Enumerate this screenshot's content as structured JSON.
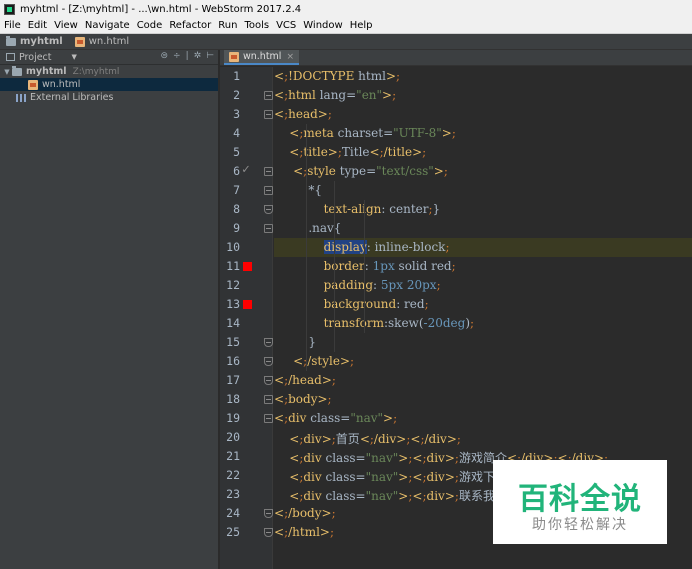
{
  "window": {
    "title": "myhtml - [Z:\\myhtml] - ...\\wn.html - WebStorm 2017.2.4"
  },
  "menu": [
    "File",
    "Edit",
    "View",
    "Navigate",
    "Code",
    "Refactor",
    "Run",
    "Tools",
    "VCS",
    "Window",
    "Help"
  ],
  "navbar": {
    "project": "myhtml",
    "file": "wn.html"
  },
  "sidebar": {
    "header_label": "Project",
    "tree": [
      {
        "label": "myhtml",
        "path": "Z:\\myhtml",
        "icon": "folder-icon"
      },
      {
        "label": "wn.html",
        "icon": "html-file-icon"
      },
      {
        "label": "External Libraries",
        "icon": "library-icon"
      }
    ]
  },
  "editor": {
    "tab_label": "wn.html",
    "current_line": 10,
    "breakpoint_lines": [
      11,
      13
    ],
    "check_line": 6,
    "lines": [
      {
        "n": 1,
        "text": "<!DOCTYPE html>"
      },
      {
        "n": 2,
        "text": "<html lang=\"en\">"
      },
      {
        "n": 3,
        "text": "<head>"
      },
      {
        "n": 4,
        "text": "    <meta charset=\"UTF-8\">"
      },
      {
        "n": 5,
        "text": "    <title>Title</title>"
      },
      {
        "n": 6,
        "text": "     <style type=\"text/css\">"
      },
      {
        "n": 7,
        "text": "         *{"
      },
      {
        "n": 8,
        "text": "             text-align: center;}"
      },
      {
        "n": 9,
        "text": "         .nav{"
      },
      {
        "n": 10,
        "text": "             display: inline-block;"
      },
      {
        "n": 11,
        "text": "             border: 1px solid red;"
      },
      {
        "n": 12,
        "text": "             padding: 5px 20px;"
      },
      {
        "n": 13,
        "text": "             background: red;"
      },
      {
        "n": 14,
        "text": "             transform:skew(-20deg);"
      },
      {
        "n": 15,
        "text": "         }"
      },
      {
        "n": 16,
        "text": "     </style>"
      },
      {
        "n": 17,
        "text": "</head>"
      },
      {
        "n": 18,
        "text": "<body>"
      },
      {
        "n": 19,
        "text": "<div class=\"nav\">"
      },
      {
        "n": 20,
        "text": "    <div>首页</div></div>"
      },
      {
        "n": 21,
        "text": "    <div class=\"nav\"><div>游戏简介</div></div>"
      },
      {
        "n": 22,
        "text": "    <div class=\"nav\"><div>游戏下载"
      },
      {
        "n": 23,
        "text": "    <div class=\"nav\"><div>联系我们"
      },
      {
        "n": 24,
        "text": "</body>"
      },
      {
        "n": 25,
        "text": "</html>"
      }
    ]
  },
  "watermark": {
    "title": "百科全说",
    "subtitle": "助你轻松解决"
  }
}
